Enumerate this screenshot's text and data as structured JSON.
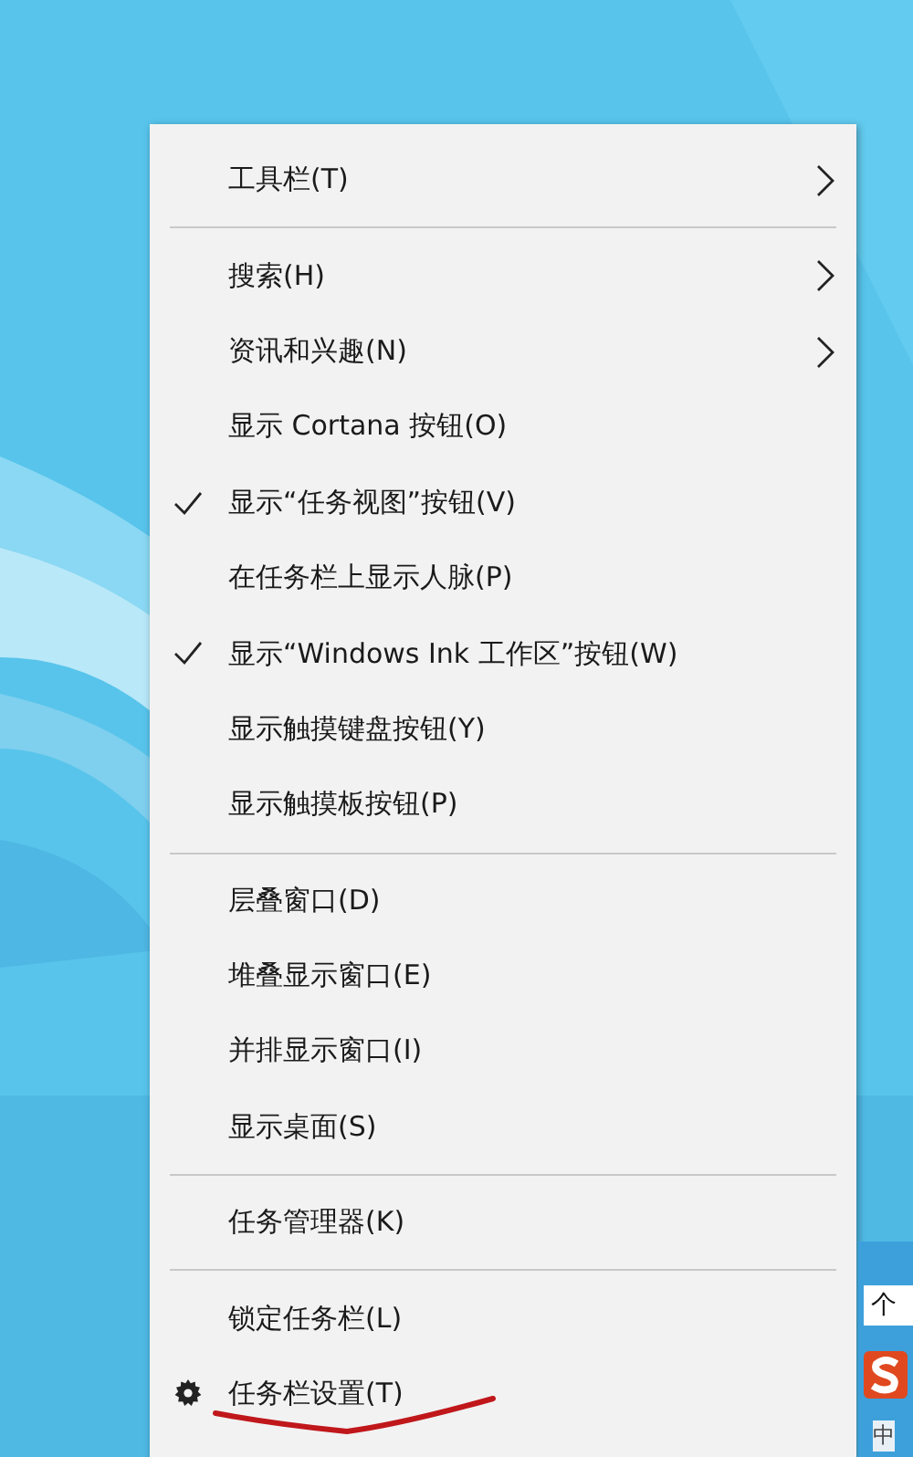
{
  "context_menu": {
    "groups": [
      [
        {
          "label": "工具栏(T)",
          "checked": false,
          "has_submenu": true,
          "kind": "text"
        }
      ],
      [
        {
          "label": "搜索(H)",
          "checked": false,
          "has_submenu": true,
          "kind": "text"
        },
        {
          "label": "资讯和兴趣(N)",
          "checked": false,
          "has_submenu": true,
          "kind": "text"
        },
        {
          "label": "显示 Cortana 按钮(O)",
          "checked": false,
          "has_submenu": false,
          "kind": "text"
        },
        {
          "label": "显示“任务视图”按钮(V)",
          "checked": true,
          "has_submenu": false,
          "kind": "text"
        },
        {
          "label": "在任务栏上显示人脉(P)",
          "checked": false,
          "has_submenu": false,
          "kind": "text"
        },
        {
          "label": "显示“Windows Ink 工作区”按钮(W)",
          "checked": true,
          "has_submenu": false,
          "kind": "text"
        },
        {
          "label": "显示触摸键盘按钮(Y)",
          "checked": false,
          "has_submenu": false,
          "kind": "text"
        },
        {
          "label": "显示触摸板按钮(P)",
          "checked": false,
          "has_submenu": false,
          "kind": "text"
        }
      ],
      [
        {
          "label": "层叠窗口(D)",
          "checked": false,
          "has_submenu": false,
          "kind": "text"
        },
        {
          "label": "堆叠显示窗口(E)",
          "checked": false,
          "has_submenu": false,
          "kind": "text"
        },
        {
          "label": "并排显示窗口(I)",
          "checked": false,
          "has_submenu": false,
          "kind": "text"
        },
        {
          "label": "显示桌面(S)",
          "checked": false,
          "has_submenu": false,
          "kind": "text"
        }
      ],
      [
        {
          "label": "任务管理器(K)",
          "checked": false,
          "has_submenu": false,
          "kind": "text"
        }
      ],
      [
        {
          "label": "锁定任务栏(L)",
          "checked": false,
          "has_submenu": false,
          "kind": "text"
        },
        {
          "label": "任务栏设置(T)",
          "checked": false,
          "has_submenu": false,
          "kind": "gear"
        }
      ]
    ]
  },
  "tray": {
    "tooltip": "个",
    "ime_indicator": "中"
  }
}
